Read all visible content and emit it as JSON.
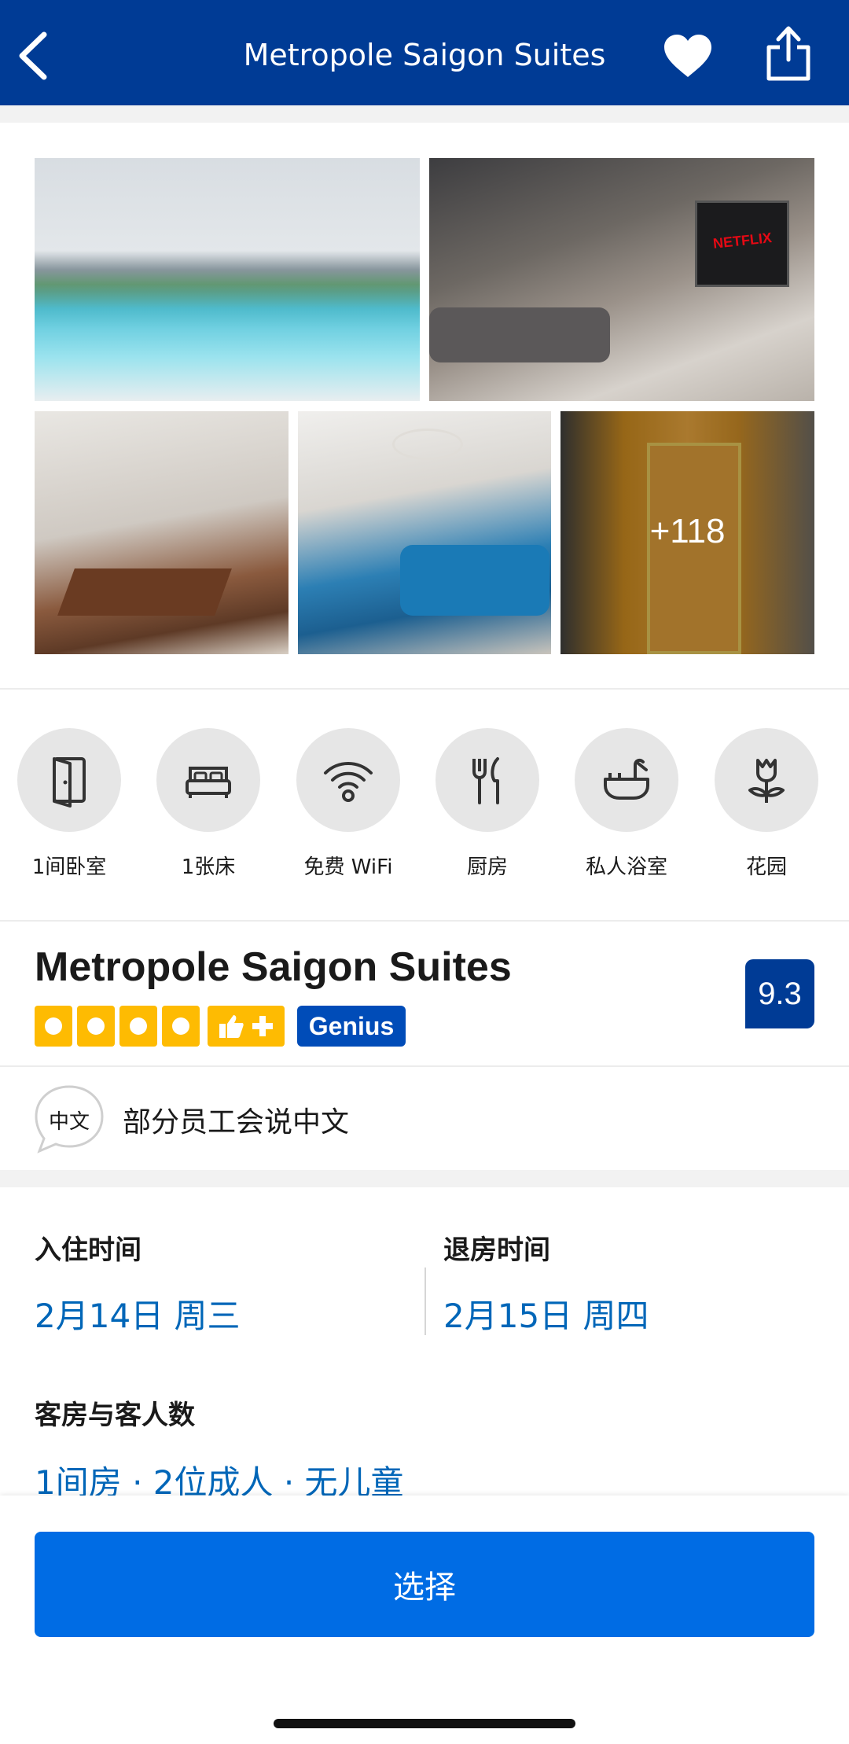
{
  "header": {
    "title": "Metropole Saigon Suites",
    "back_icon": "chevron-left-icon",
    "favorite_icon": "heart-icon",
    "share_icon": "share-icon"
  },
  "gallery": {
    "photos": [
      {
        "name": "pool-photo",
        "depicts": "rooftop pool with city skyline"
      },
      {
        "name": "living-room-photo",
        "depicts": "living room with TV",
        "text": "NETFLIX"
      },
      {
        "name": "dining-room-photo",
        "depicts": "dining room"
      },
      {
        "name": "lounge-photo",
        "depicts": "blue sofa lounge"
      },
      {
        "name": "entrance-photo",
        "depicts": "building entrance"
      }
    ],
    "more_count": "+118"
  },
  "facilities": [
    {
      "label": "1间卧室",
      "icon": "door-icon"
    },
    {
      "label": "1张床",
      "icon": "bed-icon"
    },
    {
      "label": "免费 WiFi",
      "icon": "wifi-icon"
    },
    {
      "label": "厨房",
      "icon": "kitchen-icon"
    },
    {
      "label": "私人浴室",
      "icon": "bathtub-icon"
    },
    {
      "label": "花园",
      "icon": "flower-icon"
    }
  ],
  "hotel": {
    "name": "Metropole Saigon Suites",
    "score": "9.3",
    "star_rating": 4,
    "badge": "Genius",
    "colors": {
      "brand": "#003b95",
      "star": "#febb02",
      "genius": "#004cb8",
      "accent": "#006ce4",
      "link": "#0066b8"
    }
  },
  "language": {
    "icon_text": "中文",
    "text": "部分员工会说中文"
  },
  "stay": {
    "checkin_label": "入住时间",
    "checkin_value": "2月14日 周三",
    "checkout_label": "退房时间",
    "checkout_value": "2月15日 周四",
    "guests_label": "客房与客人数",
    "guests_value": "1间房 · 2位成人 · 无儿童"
  },
  "actions": {
    "select_label": "选择"
  }
}
